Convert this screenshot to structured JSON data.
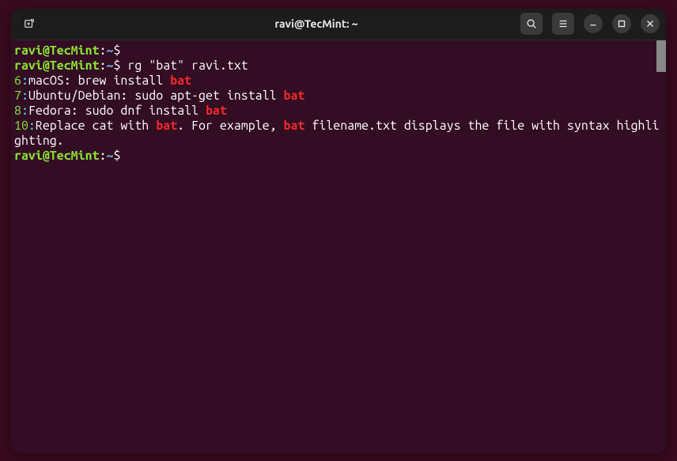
{
  "titlebar": {
    "title": "ravi@TecMint: ~"
  },
  "prompt": {
    "userhost": "ravi@TecMint",
    "colon": ":",
    "path": "~",
    "dollar": "$"
  },
  "lines": {
    "l1": {
      "cmd": ""
    },
    "l2": {
      "cmd": " rg \"bat\" ravi.txt"
    },
    "l3": {
      "num": "6",
      "sep": ":",
      "pre": "macOS: brew install ",
      "match": "bat",
      "post": ""
    },
    "l4": {
      "num": "7",
      "sep": ":",
      "pre": "Ubuntu/Debian: sudo apt-get install ",
      "match": "bat",
      "post": ""
    },
    "l5": {
      "num": "8",
      "sep": ":",
      "pre": "Fedora: sudo dnf install ",
      "match": "bat",
      "post": ""
    },
    "l6": {
      "num": "10",
      "sep": ":",
      "pre": "Replace cat with ",
      "m1": "bat",
      "mid": ". For example, ",
      "m2": "bat",
      "post": " filename.txt displays the file with syntax highlighting."
    },
    "l7": {
      "cmd": ""
    }
  },
  "colors": {
    "bg_outer": "#3a0a1f",
    "bg_term": "#330d24",
    "prompt_user": "#8ae234",
    "prompt_path": "#729fcf",
    "match": "#ef2929",
    "line_num": "#8ae234",
    "sep": "#34e2e2"
  }
}
